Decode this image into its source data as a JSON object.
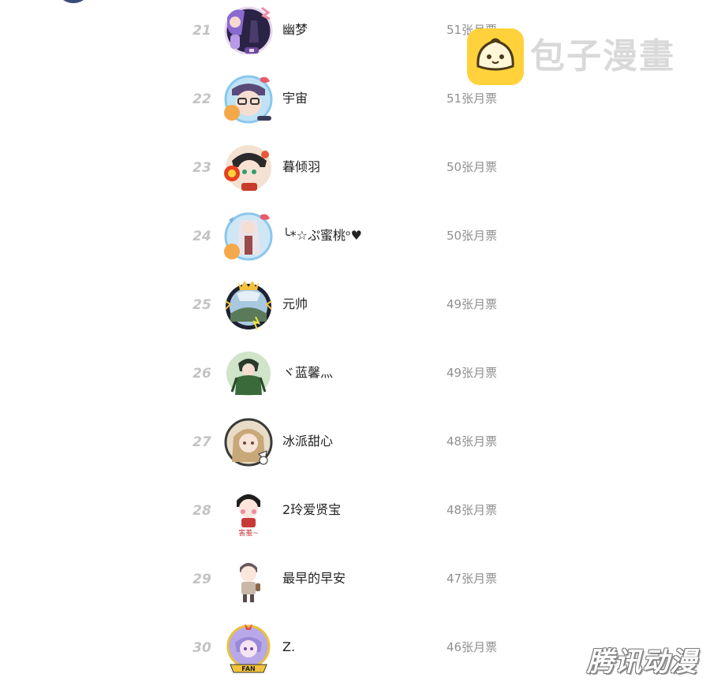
{
  "ranking": {
    "rows": [
      {
        "rank": "21",
        "name": "幽梦",
        "votes": "51张月票",
        "avatar_icon": "avatar-anime-purple-hair-icon"
      },
      {
        "rank": "22",
        "name": "宇宙",
        "votes": "51张月票",
        "avatar_icon": "avatar-anime-glasses-icon"
      },
      {
        "rank": "23",
        "name": "暮倾羽",
        "votes": "50张月票",
        "avatar_icon": "avatar-anime-green-eyes-icon"
      },
      {
        "rank": "24",
        "name": "╰*☆ぷ蜜桃ᵒ♥",
        "votes": "50张月票",
        "avatar_icon": "avatar-anime-white-hair-icon"
      },
      {
        "rank": "25",
        "name": "元帅",
        "votes": "49张月票",
        "avatar_icon": "avatar-landscape-crown-frame-icon"
      },
      {
        "rank": "26",
        "name": "ヾ蓝馨灬",
        "votes": "49张月票",
        "avatar_icon": "avatar-anime-green-coat-icon"
      },
      {
        "rank": "27",
        "name": "冰派甜心",
        "votes": "48张月票",
        "avatar_icon": "avatar-anime-blonde-girl-icon"
      },
      {
        "rank": "28",
        "name": "2玲爱贤宝",
        "votes": "48张月票",
        "avatar_icon": "avatar-chibi-shy-icon",
        "avatar_caption": "害羞~"
      },
      {
        "rank": "29",
        "name": "最早的早安",
        "votes": "47张月票",
        "avatar_icon": "avatar-chibi-boy-icon"
      },
      {
        "rank": "30",
        "name": "Z.",
        "votes": "46张月票",
        "avatar_icon": "avatar-anime-fan-badge-icon",
        "avatar_caption": "FAN"
      }
    ]
  },
  "watermarks": {
    "baozi": "包子漫畫",
    "tencent": "腾讯动漫"
  },
  "colors": {
    "rank": "#c3c3c3",
    "name": "#222222",
    "votes": "#8f8f8f",
    "baozi_yellow": "#ffd23c"
  }
}
